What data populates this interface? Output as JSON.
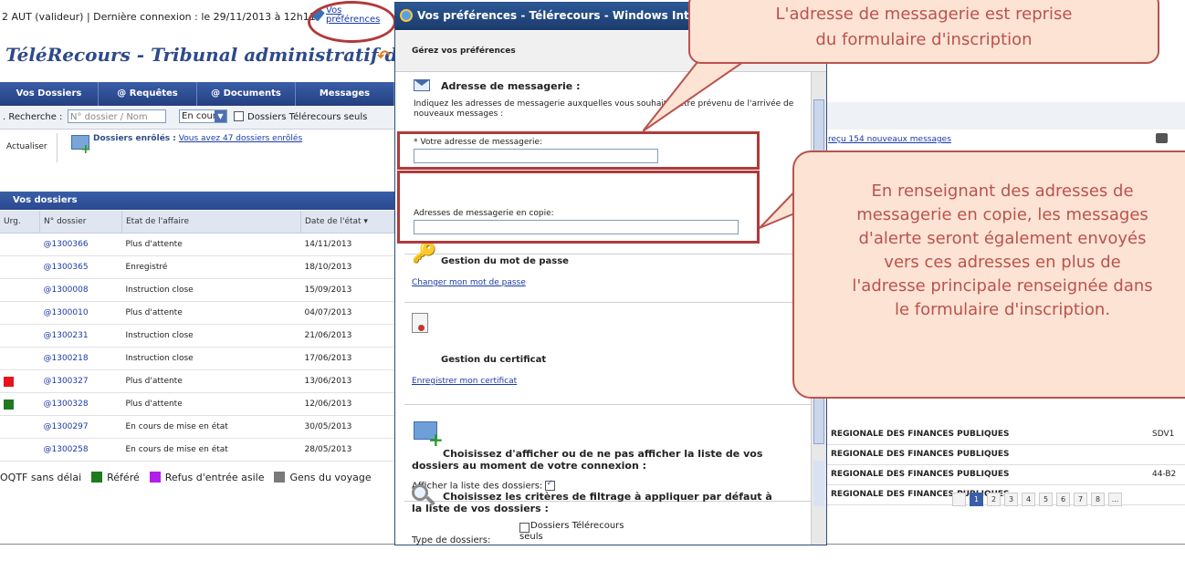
{
  "app": {
    "user_info": "2 AUT (valideur) | Dernière connexion : le 29/11/2013 à 12h11",
    "prefs_line1": "Vos",
    "prefs_line2": "préférences",
    "title": "TéléRecours - Tribunal administratif de Paris",
    "nav": [
      "Vos Dossiers",
      "@ Requêtes",
      "@ Documents",
      "Messages"
    ],
    "search_label": ". Recherche :",
    "search_placeholder": "N° dossier / Nom",
    "status_select": "En cours",
    "telerecours_only": "Dossiers Télérecours seuls",
    "refresh": "Actualiser",
    "enrolled_label": "Dossiers enrôlés :",
    "enrolled_link": "Vous avez 47 dossiers enrôlés",
    "dossiers_header": "Vos dossiers",
    "table": {
      "headers": [
        "Urg.",
        "N° dossier",
        "Etat de l'affaire",
        "Date de l'état ▾"
      ],
      "rows": [
        {
          "flag": "",
          "num": "@1300366",
          "state": "Plus d'attente",
          "date": "14/11/2013"
        },
        {
          "flag": "",
          "num": "@1300365",
          "state": "Enregistré",
          "date": "18/10/2013"
        },
        {
          "flag": "",
          "num": "@1300008",
          "state": "Instruction close",
          "date": "15/09/2013"
        },
        {
          "flag": "",
          "num": "@1300010",
          "state": "Plus d'attente",
          "date": "04/07/2013"
        },
        {
          "flag": "",
          "num": "@1300231",
          "state": "Instruction close",
          "date": "21/06/2013"
        },
        {
          "flag": "",
          "num": "@1300218",
          "state": "Instruction close",
          "date": "17/06/2013"
        },
        {
          "flag": "#e8141b",
          "num": "@1300327",
          "state": "Plus d'attente",
          "date": "13/06/2013"
        },
        {
          "flag": "#1e7a1e",
          "num": "@1300328",
          "state": "Plus d'attente",
          "date": "12/06/2013"
        },
        {
          "flag": "",
          "num": "@1300297",
          "state": "En cours de mise en état",
          "date": "30/05/2013"
        },
        {
          "flag": "",
          "num": "@1300258",
          "state": "En cours de mise en état",
          "date": "28/05/2013"
        }
      ]
    },
    "legend": [
      {
        "label": "OQTF sans délai",
        "color": ""
      },
      {
        "label": "Référé",
        "color": "#1e7a1e"
      },
      {
        "label": "Refus d'entrée asile",
        "color": "#b31ee8"
      },
      {
        "label": "Gens du voyage",
        "color": "#7a7a7a"
      }
    ],
    "right": {
      "link": "reçu 154 nouveaux messages",
      "rows": [
        {
          "text": "REGIONALE DES FINANCES PUBLIQUES",
          "code": "SDV1"
        },
        {
          "text": "REGIONALE DES FINANCES PUBLIQUES",
          "code": ""
        },
        {
          "text": "REGIONALE DES FINANCES PUBLIQUES",
          "code": "44-B2"
        },
        {
          "text": "REGIONALE DES FINANCES PUBLIQUES",
          "code": ""
        }
      ],
      "pages": [
        "1",
        "2",
        "3",
        "4",
        "5",
        "6",
        "7",
        "8",
        "..."
      ]
    }
  },
  "popup": {
    "window_title": "Vos préférences - Télérecours - Windows Interne",
    "manage": "Gérez vos préférences",
    "email_title": "Adresse de messagerie :",
    "email_desc_a": "Indiquez les adresses de messagerie auxquelles vous souhaitez",
    "email_desc_b": "être prévenu de l'arrivée de",
    "email_desc_c": "nouveaux messages :",
    "main_email_label": "* Votre adresse de messagerie:",
    "cc_email_label": "Adresses de messagerie en copie:",
    "password_title": "Gestion du mot de passe",
    "password_link": "Changer mon mot de passe",
    "cert_title": "Gestion du certificat",
    "cert_link": "Enregistrer mon certificat",
    "show_list_title_1": "Choisissez d'afficher ou de ne pas afficher la liste de vos",
    "show_list_title_2": "dossiers au moment de votre connexion :",
    "show_list_label": "Afficher la liste des dossiers:",
    "filter_title_1": "Choisissez les critères de filtrage à appliquer par défaut à",
    "filter_title_2": "la liste de vos dossiers :",
    "type_label": "Type de dossiers:",
    "type_option_1": "Dossiers Télérecours",
    "type_option_2": "seuls"
  },
  "callouts": {
    "top_line1": "L'adresse de messagerie est reprise",
    "top_line2": "du formulaire d'inscription",
    "side_lines": [
      "En renseignant des adresses de",
      "messagerie en copie, les messages",
      "d'alerte seront également envoyés",
      "vers ces adresses en plus de",
      "l'adresse principale renseignée dans",
      "le formulaire d'inscription."
    ]
  }
}
